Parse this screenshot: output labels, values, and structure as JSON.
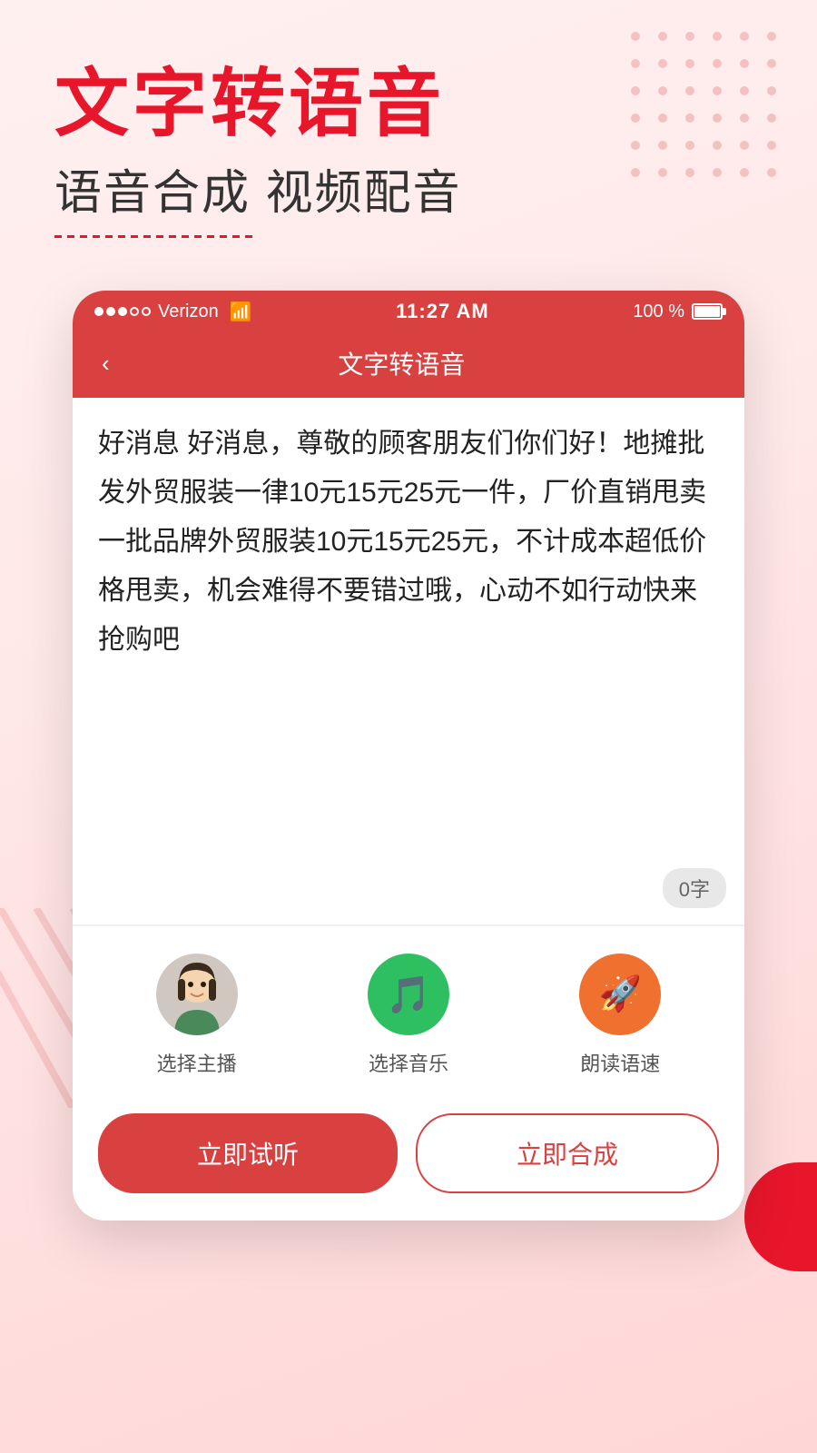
{
  "hero": {
    "title": "文字转语音",
    "subtitle": "语音合成 视频配音"
  },
  "status_bar": {
    "carrier": "Verizon",
    "time": "11:27 AM",
    "battery": "100 %"
  },
  "app_header": {
    "title": "文字转语音",
    "back_label": "<"
  },
  "text_area": {
    "content": "好消息 好消息，尊敬的顾客朋友们你们好！地摊批发外贸服装一律10元15元25元一件，厂价直销甩卖一批品牌外贸服装10元15元25元，不计成本超低价格甩卖，机会难得不要错过哦，心动不如行动快来抢购吧",
    "word_count": "0字"
  },
  "controls": [
    {
      "id": "host",
      "label": "选择主播",
      "icon_type": "avatar"
    },
    {
      "id": "music",
      "label": "选择音乐",
      "icon_type": "music"
    },
    {
      "id": "speed",
      "label": "朗读语速",
      "icon_type": "rocket"
    }
  ],
  "buttons": {
    "listen": "立即试听",
    "synthesize": "立即合成"
  },
  "colors": {
    "primary_red": "#d94040",
    "hero_red": "#e8162b",
    "green": "#2ec060",
    "orange": "#f07030"
  }
}
